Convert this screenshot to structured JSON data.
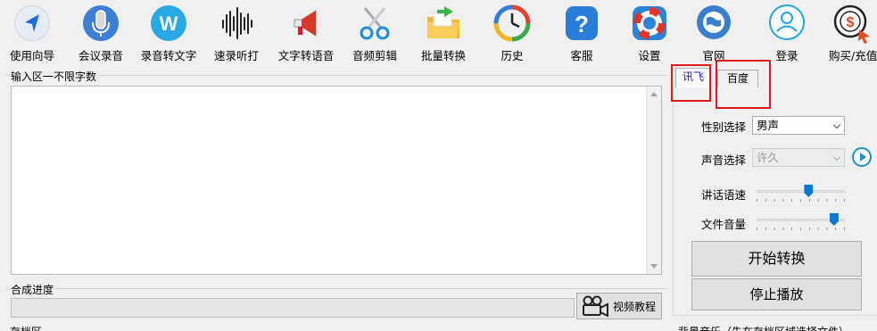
{
  "toolbar": {
    "items": [
      {
        "label": "使用向导",
        "icon": "navigation-arrow-icon"
      },
      {
        "label": "会议录音",
        "icon": "microphone-icon"
      },
      {
        "label": "录音转文字",
        "icon": "w-letter-icon"
      },
      {
        "label": "速录听打",
        "icon": "soundwave-icon"
      },
      {
        "label": "文字转语音",
        "icon": "megaphone-icon"
      },
      {
        "label": "音频剪辑",
        "icon": "scissors-icon"
      },
      {
        "label": "批量转换",
        "icon": "folder-arrow-icon"
      },
      {
        "label": "历史",
        "icon": "history-clock-icon"
      },
      {
        "label": "客服",
        "icon": "question-icon"
      },
      {
        "label": "设置",
        "icon": "lifebuoy-icon"
      },
      {
        "label": "官网",
        "icon": "globe-icon"
      },
      {
        "label": "登录",
        "icon": "user-icon"
      },
      {
        "label": "购买/充值",
        "icon": "dollar-cursor-icon"
      }
    ]
  },
  "input_area": {
    "group_label": "输入区一不限字数",
    "text": ""
  },
  "synthesis": {
    "group_label": "合成进度",
    "progress_percent": 0,
    "video_button": "视频教程"
  },
  "tabs": {
    "items": [
      {
        "label": "讯飞",
        "active": true
      },
      {
        "label": "百度",
        "active": false
      }
    ]
  },
  "voice_settings": {
    "gender_label": "性别选择",
    "gender_value": "男声",
    "voice_label": "声音选择",
    "voice_value": "许久",
    "speed_label": "讲话语速",
    "speed_percent": 60,
    "volume_label": "文件音量",
    "volume_percent": 92,
    "start_button": "开始转换",
    "stop_button": "停止播放"
  },
  "bottom": {
    "left_label": "存档区",
    "right_label": "背景音乐（先在存档区域选择文件）"
  },
  "colors": {
    "accent_blue": "#0078d7",
    "highlight_red": "#e0191d"
  }
}
